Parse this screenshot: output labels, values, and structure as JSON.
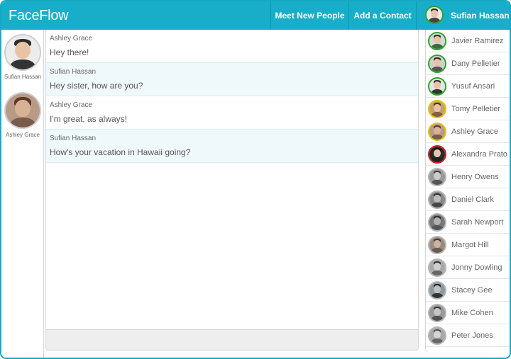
{
  "app": {
    "logo": "FaceFlow"
  },
  "nav": {
    "meet_label": "Meet New People",
    "add_label": "Add a Contact",
    "current_user": "Sufian Hassan"
  },
  "left_users": [
    {
      "name": "Sufian Hassan"
    },
    {
      "name": "Ashley Grace"
    }
  ],
  "messages": [
    {
      "from": "Ashley Grace",
      "text": "Hey there!"
    },
    {
      "from": "Sufian Hassan",
      "text": "Hey sister, how are you?"
    },
    {
      "from": "Ashley Grace",
      "text": "I'm great, as always!"
    },
    {
      "from": "Sufian Hassan",
      "text": "How's your vacation in Hawaii going?"
    }
  ],
  "contacts": [
    {
      "name": "Javier Ramirez",
      "status": "online"
    },
    {
      "name": "Dany Pelletier",
      "status": "online"
    },
    {
      "name": "Yusuf Ansari",
      "status": "online"
    },
    {
      "name": "Tomy Pelletier",
      "status": "away"
    },
    {
      "name": "Ashley Grace",
      "status": "away"
    },
    {
      "name": "Alexandra Prato",
      "status": "busy"
    },
    {
      "name": "Henry Owens",
      "status": "offline"
    },
    {
      "name": "Daniel Clark",
      "status": "offline"
    },
    {
      "name": "Sarah Newport",
      "status": "offline"
    },
    {
      "name": "Margot Hill",
      "status": "offline"
    },
    {
      "name": "Jonny Dowling",
      "status": "offline"
    },
    {
      "name": "Stacey Gee",
      "status": "offline"
    },
    {
      "name": "Mike Cohen",
      "status": "offline"
    },
    {
      "name": "Peter Jones",
      "status": "offline"
    }
  ],
  "colors": {
    "header": "#18aec9",
    "online": "#2aa52a",
    "away": "#e0c400",
    "busy": "#d22020",
    "offline": "#b5b5b5",
    "message_alt_bg": "#eff8fb"
  }
}
